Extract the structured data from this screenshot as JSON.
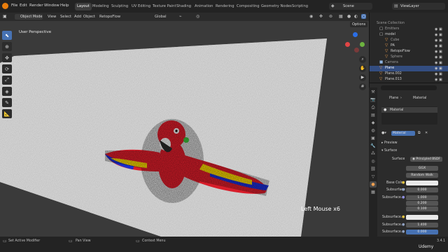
{
  "menu": [
    "File",
    "Edit",
    "Render",
    "Window",
    "Help"
  ],
  "workspaces": [
    "Layout",
    "Modeling",
    "Sculpting",
    "UV Editing",
    "Texture Paint",
    "Shading",
    "Animation",
    "Rendering",
    "Compositing",
    "Geometry Nodes",
    "Scripting"
  ],
  "scene_name": "Scene",
  "view_layer": "ViewLayer",
  "viewport_header": {
    "mode": "Object Mode",
    "view": "View",
    "select": "Select",
    "add": "Add",
    "object": "Object",
    "addon": "RetopoFlow",
    "orientation": "Global",
    "options": "Options"
  },
  "viewport": {
    "perspective_label": "User Perspective",
    "overlay_text": "Left Mouse x6"
  },
  "outliner": {
    "rows": [
      {
        "label": "Scene Collection"
      },
      {
        "label": "Emitters"
      },
      {
        "label": "model"
      },
      {
        "label": "Cube"
      },
      {
        "label": "PA"
      },
      {
        "label": "RetopoFlow"
      },
      {
        "label": "Sphere"
      },
      {
        "label": "Camera"
      },
      {
        "label": "Plane"
      },
      {
        "label": "Plane.002"
      },
      {
        "label": "Plane.013"
      }
    ]
  },
  "properties": {
    "breadcrumb_object": "Plane",
    "breadcrumb_material": "Material",
    "slot_name": "Material",
    "material_name": "Material",
    "preview_label": "Preview",
    "surface_panel": "Surface",
    "surface_label": "Surface",
    "surface_shader": "Principled BSDF",
    "distribution": "GGX",
    "subsurface_method": "Random Walk",
    "fields": [
      {
        "label": "Base Color",
        "value": ""
      },
      {
        "label": "Subsurface",
        "value": "0.000"
      },
      {
        "label": "Subsurface...",
        "value": "1.000"
      },
      {
        "label": "",
        "value": "0.200"
      },
      {
        "label": "",
        "value": "0.100"
      },
      {
        "label": "Subsurface...",
        "value": ""
      },
      {
        "label": "Subsurface...",
        "value": "1.400"
      },
      {
        "label": "Subsurface...",
        "value": "0.000"
      }
    ]
  },
  "statusbar": {
    "left": "Set Active Modifier",
    "middle": "Pan View",
    "right": "Context Menu",
    "version": "3.4.1",
    "watermark": "Udemy"
  }
}
